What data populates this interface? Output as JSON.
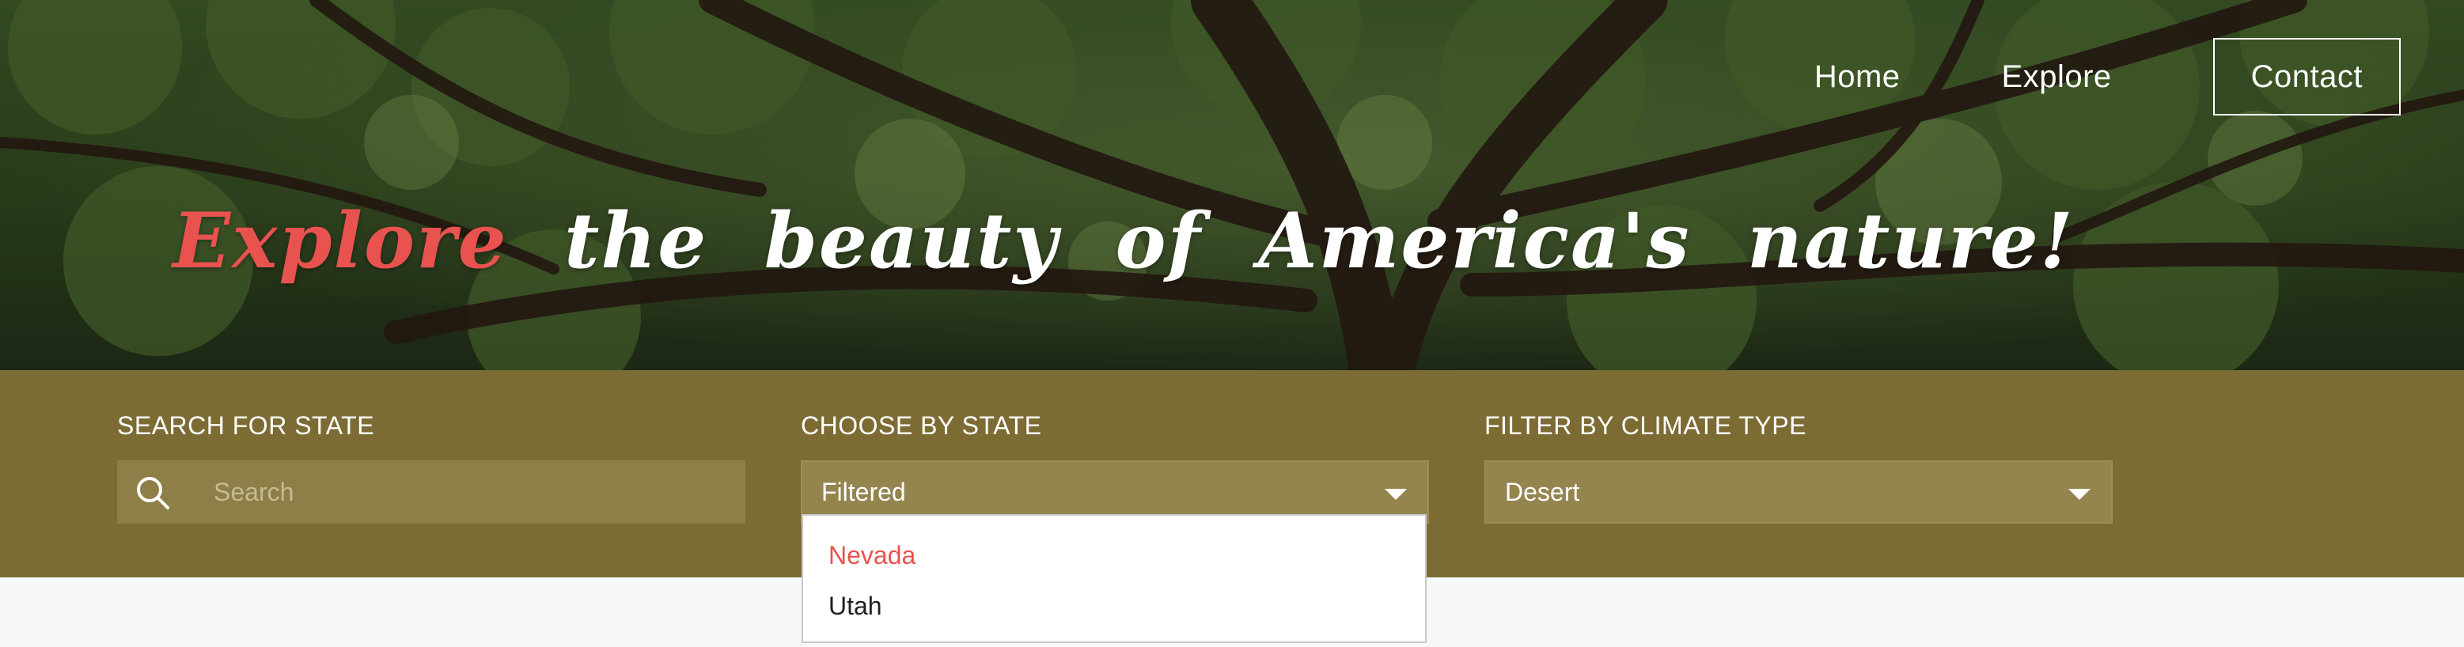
{
  "nav": {
    "items": [
      {
        "label": "Home"
      },
      {
        "label": "Explore"
      },
      {
        "label": "Contact"
      }
    ]
  },
  "hero": {
    "headline_accent": "Explore",
    "headline_rest": "the beauty of America's nature!"
  },
  "filters": {
    "search": {
      "label": "SEARCH FOR STATE",
      "placeholder": "Search",
      "value": "",
      "icon": "search-icon"
    },
    "state": {
      "label": "CHOOSE BY STATE",
      "selected": "Filtered",
      "icon": "chevron-down-icon",
      "options": [
        {
          "label": "Nevada",
          "highlighted": true
        },
        {
          "label": "Utah",
          "highlighted": false
        }
      ]
    },
    "climate": {
      "label": "FILTER BY CLIMATE TYPE",
      "selected": "Desert",
      "icon": "chevron-down-icon"
    }
  },
  "colors": {
    "accent": "#e8524f",
    "filter_bar": "#7c6c34",
    "control_bg": "#94844e"
  }
}
